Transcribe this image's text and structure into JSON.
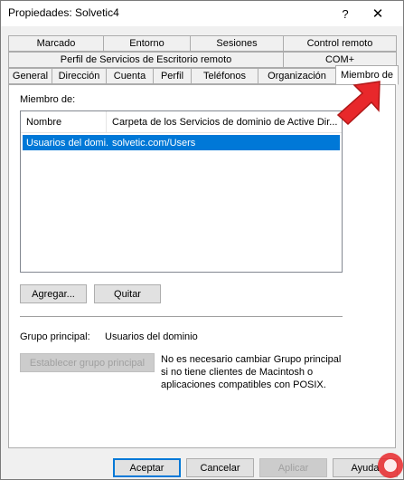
{
  "window": {
    "title": "Propiedades: Solvetic4",
    "help_glyph": "?",
    "close_glyph": "✕"
  },
  "tabs": {
    "row1": [
      "Marcado",
      "Entorno",
      "Sesiones",
      "Control remoto"
    ],
    "row2": [
      "Perfil de Servicios de Escritorio remoto",
      "COM+"
    ],
    "row3": [
      "General",
      "Dirección",
      "Cuenta",
      "Perfil",
      "Teléfonos",
      "Organización",
      "Miembro de"
    ],
    "active": "Miembro de"
  },
  "member_of": {
    "label": "Miembro de:",
    "columns": [
      "Nombre",
      "Carpeta de los Servicios de dominio de Active Dir..."
    ],
    "rows": [
      {
        "name": "Usuarios del domi...",
        "folder": "solvetic.com/Users",
        "selected": true
      }
    ],
    "add_button": "Agregar...",
    "remove_button": "Quitar"
  },
  "primary_group": {
    "label": "Grupo principal:",
    "value": "Usuarios del dominio",
    "set_button": "Establecer grupo principal",
    "note": "No es necesario cambiar Grupo principal si no tiene clientes de Macintosh o aplicaciones compatibles con POSIX."
  },
  "footer": {
    "ok": "Aceptar",
    "cancel": "Cancelar",
    "apply": "Aplicar",
    "help": "Ayuda"
  },
  "colors": {
    "selection": "#0078d7",
    "arrow": "#e8282b",
    "default_button_border": "#0078d7"
  }
}
